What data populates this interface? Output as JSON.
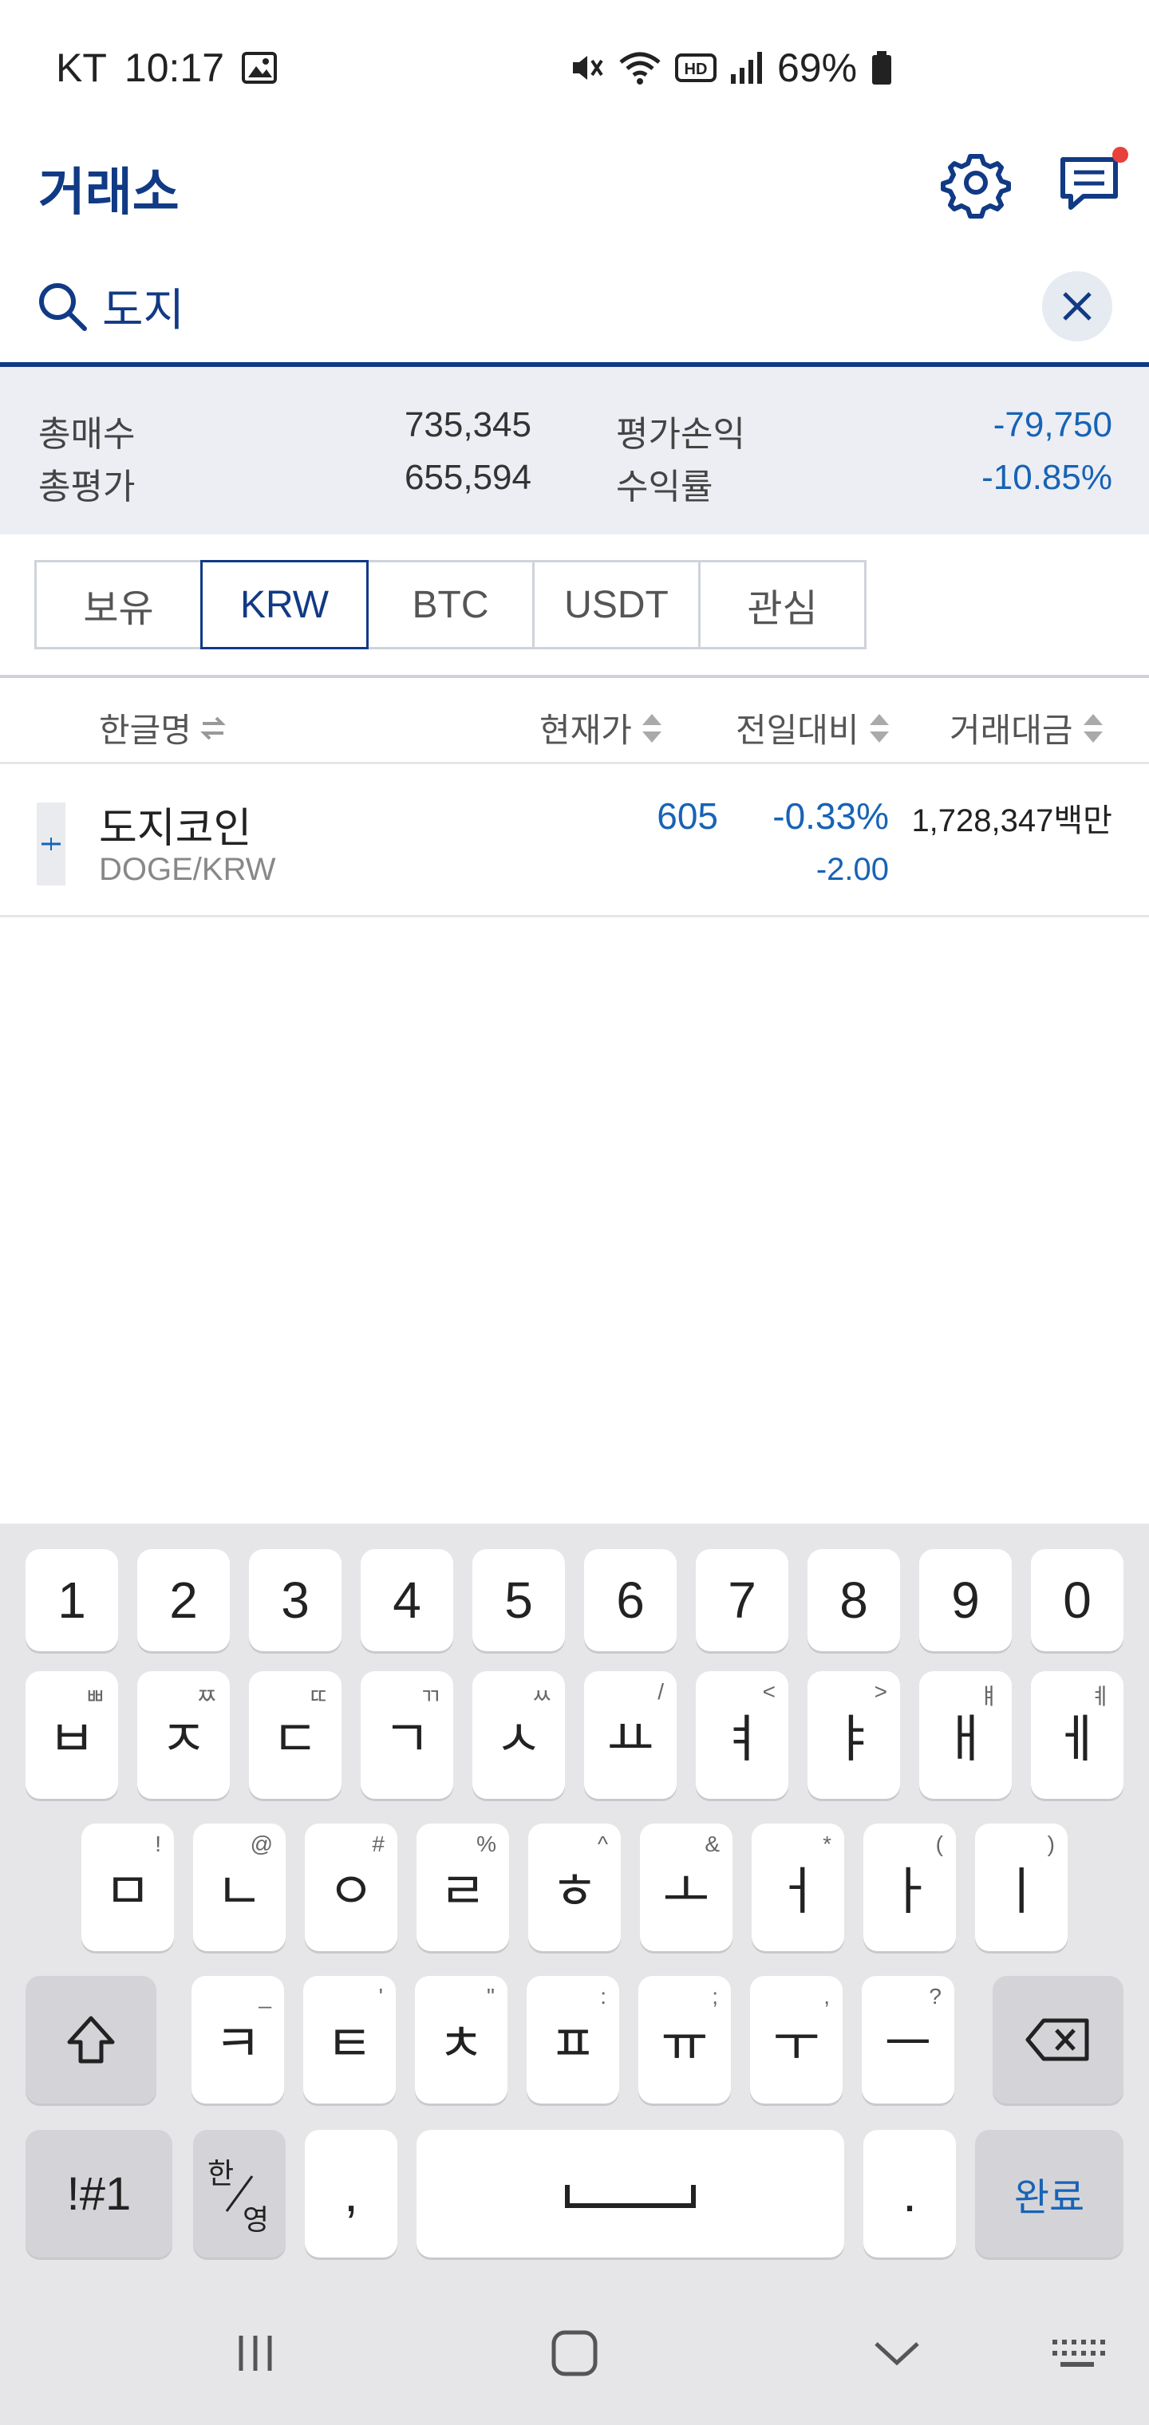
{
  "status_bar": {
    "carrier": "KT",
    "time": "10:17",
    "battery": "69%"
  },
  "header": {
    "title": "거래소"
  },
  "search": {
    "value": "도지"
  },
  "summary": {
    "total_buy_label": "총매수",
    "total_buy_value": "735,345",
    "total_eval_label": "총평가",
    "total_eval_value": "655,594",
    "pnl_label": "평가손익",
    "pnl_value": "-79,750",
    "return_label": "수익률",
    "return_value": "-10.85%"
  },
  "tabs": [
    {
      "label": "보유",
      "active": false
    },
    {
      "label": "KRW",
      "active": true
    },
    {
      "label": "BTC",
      "active": false
    },
    {
      "label": "USDT",
      "active": false
    },
    {
      "label": "관심",
      "active": false
    }
  ],
  "table": {
    "headers": {
      "name": "한글명",
      "price": "현재가",
      "change": "전일대비",
      "volume": "거래대금"
    },
    "rows": [
      {
        "name": "도지코인",
        "pair": "DOGE/KRW",
        "price": "605",
        "change_pct": "-0.33%",
        "change_abs": "-2.00",
        "volume": "1,728,347백만"
      }
    ]
  },
  "keyboard": {
    "numbers": [
      "1",
      "2",
      "3",
      "4",
      "5",
      "6",
      "7",
      "8",
      "9",
      "0"
    ],
    "row1": [
      {
        "k": "ㅂ",
        "s": "ㅃ"
      },
      {
        "k": "ㅈ",
        "s": "ㅉ"
      },
      {
        "k": "ㄷ",
        "s": "ㄸ"
      },
      {
        "k": "ㄱ",
        "s": "ㄲ"
      },
      {
        "k": "ㅅ",
        "s": "ㅆ"
      },
      {
        "k": "ㅛ",
        "s": "/"
      },
      {
        "k": "ㅕ",
        "s": "<"
      },
      {
        "k": "ㅑ",
        "s": ">"
      },
      {
        "k": "ㅐ",
        "s": "ㅒ"
      },
      {
        "k": "ㅔ",
        "s": "ㅖ"
      }
    ],
    "row2": [
      {
        "k": "ㅁ",
        "s": "!"
      },
      {
        "k": "ㄴ",
        "s": "@"
      },
      {
        "k": "ㅇ",
        "s": "#"
      },
      {
        "k": "ㄹ",
        "s": "%"
      },
      {
        "k": "ㅎ",
        "s": "^"
      },
      {
        "k": "ㅗ",
        "s": "&"
      },
      {
        "k": "ㅓ",
        "s": "*"
      },
      {
        "k": "ㅏ",
        "s": "("
      },
      {
        "k": "ㅣ",
        "s": ")"
      }
    ],
    "row3": [
      {
        "k": "ㅋ",
        "s": "_"
      },
      {
        "k": "ㅌ",
        "s": "'"
      },
      {
        "k": "ㅊ",
        "s": "\""
      },
      {
        "k": "ㅍ",
        "s": ":"
      },
      {
        "k": "ㅠ",
        "s": ";"
      },
      {
        "k": "ㅜ",
        "s": ","
      },
      {
        "k": "ㅡ",
        "s": "?"
      }
    ],
    "symbols_label": "!#1",
    "lang_top": "한",
    "lang_bottom": "영",
    "comma": ",",
    "period": ".",
    "done_label": "완료"
  },
  "colors": {
    "brand": "#113a85",
    "negative": "#1763b6",
    "notification": "#e8403a"
  }
}
